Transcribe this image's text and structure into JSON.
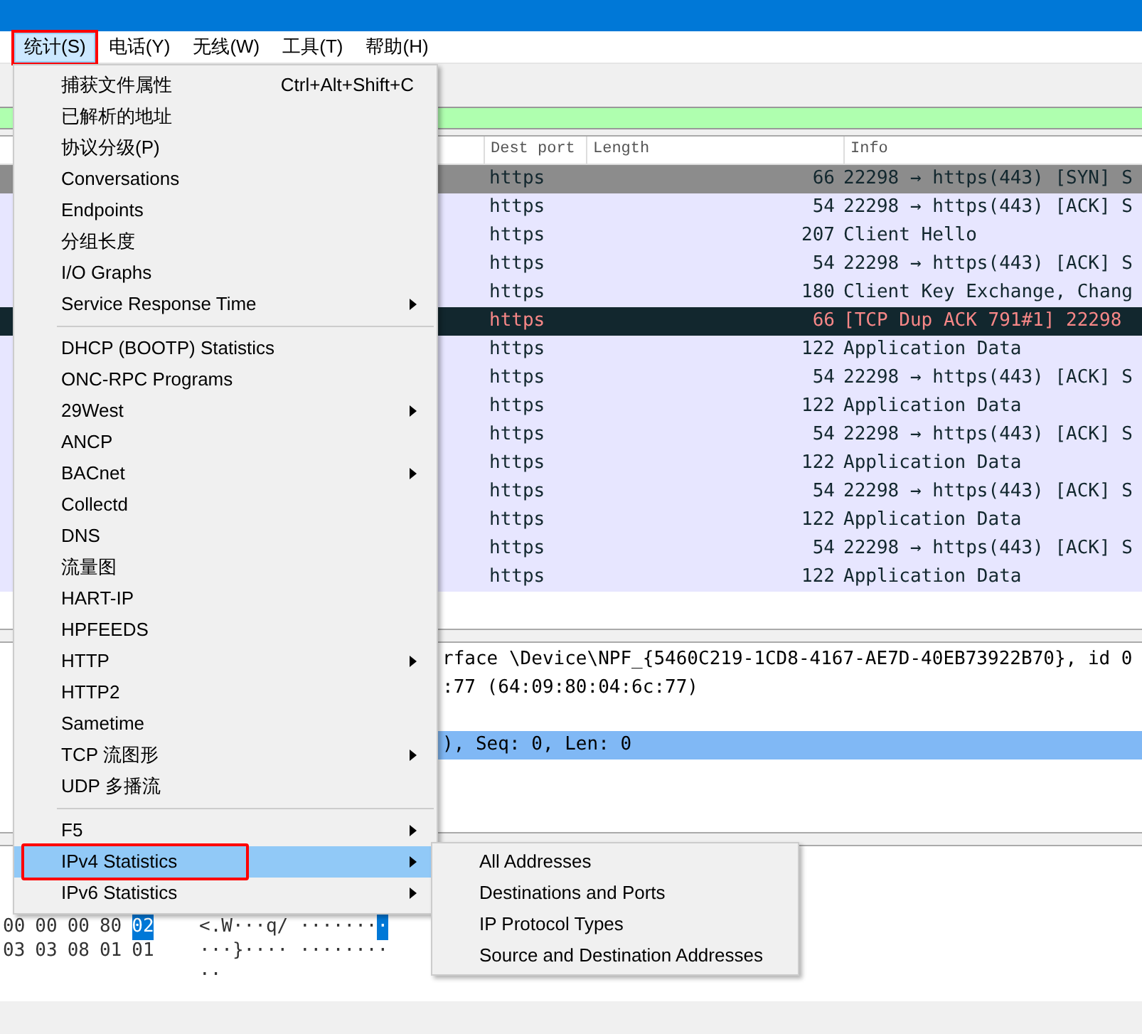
{
  "menu_bar": [
    {
      "label": "统计(S)",
      "selected": true,
      "annotated": true
    },
    {
      "label": "电话(Y)",
      "selected": false,
      "annotated": false
    },
    {
      "label": "无线(W)",
      "selected": false,
      "annotated": false
    },
    {
      "label": "工具(T)",
      "selected": false,
      "annotated": false
    },
    {
      "label": "帮助(H)",
      "selected": false,
      "annotated": false
    }
  ],
  "packet_list": {
    "columns": [
      "Dest port",
      "Length",
      "Info"
    ],
    "rows": [
      {
        "kind": "normal",
        "selected": true,
        "dest_port": "https",
        "length": "66",
        "info": "22298 → https(443) [SYN] S"
      },
      {
        "kind": "normal",
        "selected": false,
        "dest_port": "https",
        "length": "54",
        "info": "22298 → https(443) [ACK] S"
      },
      {
        "kind": "normal",
        "selected": false,
        "dest_port": "https",
        "length": "207",
        "info": "Client Hello"
      },
      {
        "kind": "normal",
        "selected": false,
        "dest_port": "https",
        "length": "54",
        "info": "22298 → https(443) [ACK] S"
      },
      {
        "kind": "normal",
        "selected": false,
        "dest_port": "https",
        "length": "180",
        "info": "Client Key Exchange, Chang"
      },
      {
        "kind": "bad_tcp",
        "selected": false,
        "dest_port": "https",
        "length": "66",
        "info": "[TCP Dup ACK 791#1] 22298"
      },
      {
        "kind": "normal",
        "selected": false,
        "dest_port": "https",
        "length": "122",
        "info": "Application Data"
      },
      {
        "kind": "normal",
        "selected": false,
        "dest_port": "https",
        "length": "54",
        "info": "22298 → https(443) [ACK] S"
      },
      {
        "kind": "normal",
        "selected": false,
        "dest_port": "https",
        "length": "122",
        "info": "Application Data"
      },
      {
        "kind": "normal",
        "selected": false,
        "dest_port": "https",
        "length": "54",
        "info": "22298 → https(443) [ACK] S"
      },
      {
        "kind": "normal",
        "selected": false,
        "dest_port": "https",
        "length": "122",
        "info": "Application Data"
      },
      {
        "kind": "normal",
        "selected": false,
        "dest_port": "https",
        "length": "54",
        "info": "22298 → https(443) [ACK] S"
      },
      {
        "kind": "normal",
        "selected": false,
        "dest_port": "https",
        "length": "122",
        "info": "Application Data"
      },
      {
        "kind": "normal",
        "selected": false,
        "dest_port": "https",
        "length": "54",
        "info": "22298 → https(443) [ACK] S"
      },
      {
        "kind": "normal",
        "selected": false,
        "dest_port": "https",
        "length": "122",
        "info": "Application Data"
      }
    ]
  },
  "details": [
    {
      "text": "rface \\Device\\NPF_{5460C219-1CD8-4167-AE7D-40EB73922B70}, id 0",
      "selected": false
    },
    {
      "text": ":77 (64:09:80:04:6c:77)",
      "selected": false
    },
    {
      "text": "), Seq: 0, Len: 0",
      "selected": true
    }
  ],
  "bytes": [
    {
      "hex": [
        {
          "text": "00",
          "selected": false
        },
        {
          "text": "00",
          "selected": false
        },
        {
          "text": "00",
          "selected": false
        },
        {
          "text": "80",
          "selected": false
        },
        {
          "text": "02",
          "selected": true
        }
      ],
      "ascii": [
        {
          "text": "<.W···q/ ·······",
          "selected": false
        },
        {
          "text": "·",
          "selected": true
        }
      ]
    },
    {
      "hex": [
        {
          "text": "03",
          "selected": false
        },
        {
          "text": "03",
          "selected": false
        },
        {
          "text": "08",
          "selected": false
        },
        {
          "text": "01",
          "selected": false
        },
        {
          "text": "01",
          "selected": false
        }
      ],
      "ascii": [
        {
          "text": "···}···· ········",
          "selected": false
        }
      ]
    },
    {
      "ascii": [
        {
          "text": "··",
          "selected": false
        }
      ]
    }
  ],
  "stats_menu": [
    {
      "kind": "item",
      "label": "捕获文件属性",
      "shortcut": "Ctrl+Alt+Shift+C",
      "submenu": false,
      "selected": false,
      "annotated": false
    },
    {
      "kind": "item",
      "label": "已解析的地址",
      "submenu": false,
      "selected": false,
      "annotated": false
    },
    {
      "kind": "item",
      "label": "协议分级(P)",
      "submenu": false,
      "selected": false,
      "annotated": false
    },
    {
      "kind": "item",
      "label": "Conversations",
      "submenu": false,
      "selected": false,
      "annotated": false
    },
    {
      "kind": "item",
      "label": "Endpoints",
      "submenu": false,
      "selected": false,
      "annotated": false
    },
    {
      "kind": "item",
      "label": "分组长度",
      "submenu": false,
      "selected": false,
      "annotated": false
    },
    {
      "kind": "item",
      "label": "I/O Graphs",
      "submenu": false,
      "selected": false,
      "annotated": false
    },
    {
      "kind": "item",
      "label": "Service Response Time",
      "submenu": true,
      "selected": false,
      "annotated": false
    },
    {
      "kind": "separator"
    },
    {
      "kind": "item",
      "label": "DHCP (BOOTP) Statistics",
      "submenu": false,
      "selected": false,
      "annotated": false
    },
    {
      "kind": "item",
      "label": "ONC-RPC Programs",
      "submenu": false,
      "selected": false,
      "annotated": false
    },
    {
      "kind": "item",
      "label": "29West",
      "submenu": true,
      "selected": false,
      "annotated": false
    },
    {
      "kind": "item",
      "label": "ANCP",
      "submenu": false,
      "selected": false,
      "annotated": false
    },
    {
      "kind": "item",
      "label": "BACnet",
      "submenu": true,
      "selected": false,
      "annotated": false
    },
    {
      "kind": "item",
      "label": "Collectd",
      "submenu": false,
      "selected": false,
      "annotated": false
    },
    {
      "kind": "item",
      "label": "DNS",
      "submenu": false,
      "selected": false,
      "annotated": false
    },
    {
      "kind": "item",
      "label": "流量图",
      "submenu": false,
      "selected": false,
      "annotated": false
    },
    {
      "kind": "item",
      "label": "HART-IP",
      "submenu": false,
      "selected": false,
      "annotated": false
    },
    {
      "kind": "item",
      "label": "HPFEEDS",
      "submenu": false,
      "selected": false,
      "annotated": false
    },
    {
      "kind": "item",
      "label": "HTTP",
      "submenu": true,
      "selected": false,
      "annotated": false
    },
    {
      "kind": "item",
      "label": "HTTP2",
      "submenu": false,
      "selected": false,
      "annotated": false
    },
    {
      "kind": "item",
      "label": "Sametime",
      "submenu": false,
      "selected": false,
      "annotated": false
    },
    {
      "kind": "item",
      "label": "TCP 流图形",
      "submenu": true,
      "selected": false,
      "annotated": false
    },
    {
      "kind": "item",
      "label": "UDP 多播流",
      "submenu": false,
      "selected": false,
      "annotated": false
    },
    {
      "kind": "separator"
    },
    {
      "kind": "item",
      "label": "F5",
      "submenu": true,
      "selected": false,
      "annotated": false
    },
    {
      "kind": "item",
      "label": "IPv4 Statistics",
      "submenu": true,
      "selected": true,
      "annotated": true
    },
    {
      "kind": "item",
      "label": "IPv6 Statistics",
      "submenu": true,
      "selected": false,
      "annotated": false
    }
  ],
  "ipv4_submenu": [
    "All Addresses",
    "Destinations and Ports",
    "IP Protocol Types",
    "Source and Destination Addresses"
  ]
}
